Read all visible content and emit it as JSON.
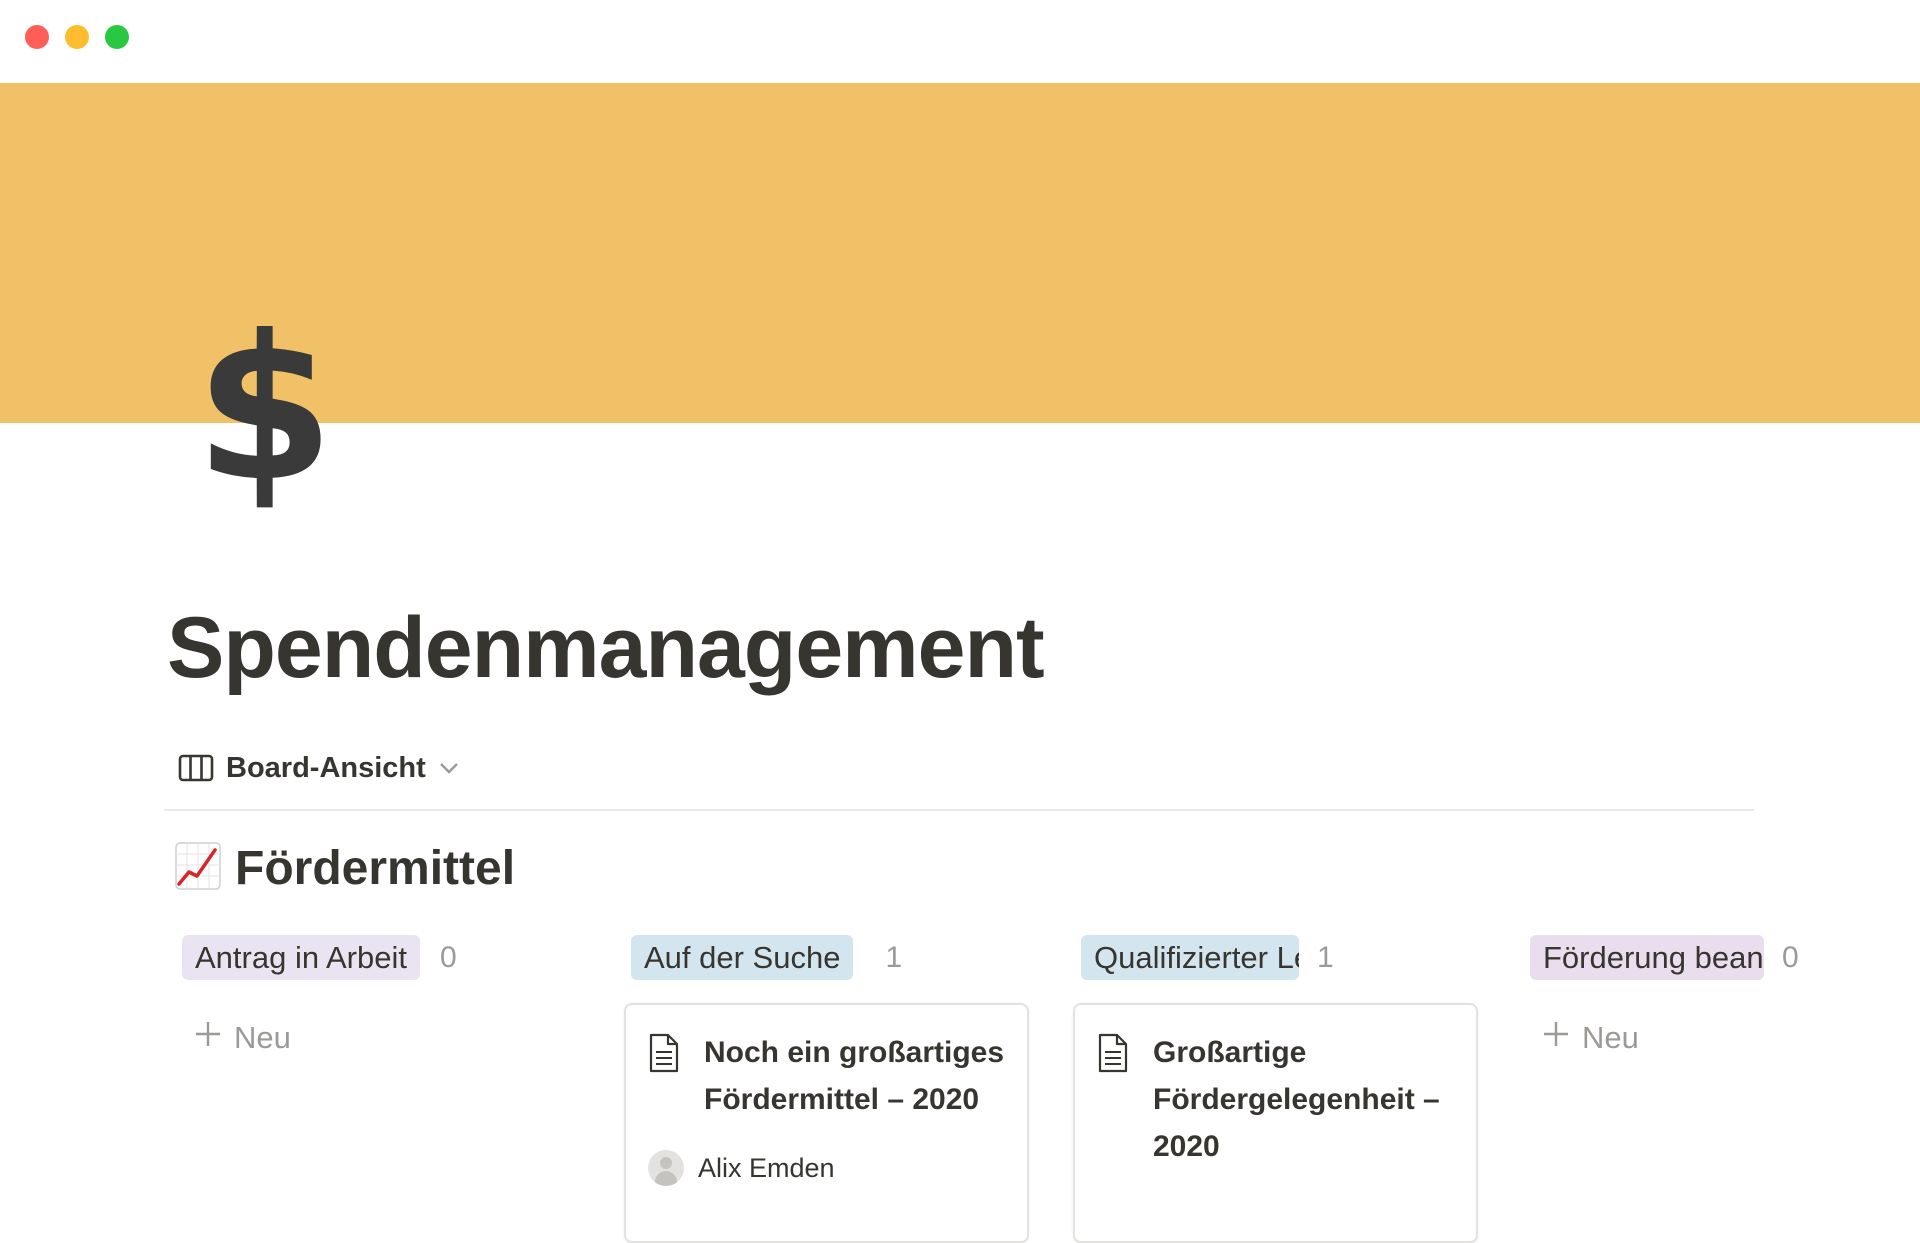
{
  "window": {
    "controls": [
      "close",
      "minimize",
      "maximize"
    ]
  },
  "cover": {
    "color": "#f0c166"
  },
  "page": {
    "icon": "$",
    "title": "Spendenmanagement"
  },
  "view": {
    "icon": "board-view-icon",
    "label": "Board-Ansicht"
  },
  "database": {
    "emoji": "chart-increasing-icon",
    "title": "Fördermittel"
  },
  "board": {
    "new_label": "Neu",
    "columns": [
      {
        "label": "Antrag in Arbeit",
        "count": "0",
        "color": "#eae4f2",
        "cards": []
      },
      {
        "label": "Auf der Suche",
        "count": "1",
        "color": "#d3e5ef",
        "cards": [
          {
            "title": "Noch ein großartiges Fördermittel – 2020",
            "person": "Alix Emden"
          }
        ]
      },
      {
        "label": "Qualifizierter Lead",
        "count": "1",
        "color": "#d3e5ef",
        "cards": [
          {
            "title": "Großartige Fördergelegenheit – 2020"
          }
        ]
      },
      {
        "label": "Förderung beantragt",
        "count": "0",
        "color": "#e8deee",
        "cards": []
      }
    ]
  }
}
